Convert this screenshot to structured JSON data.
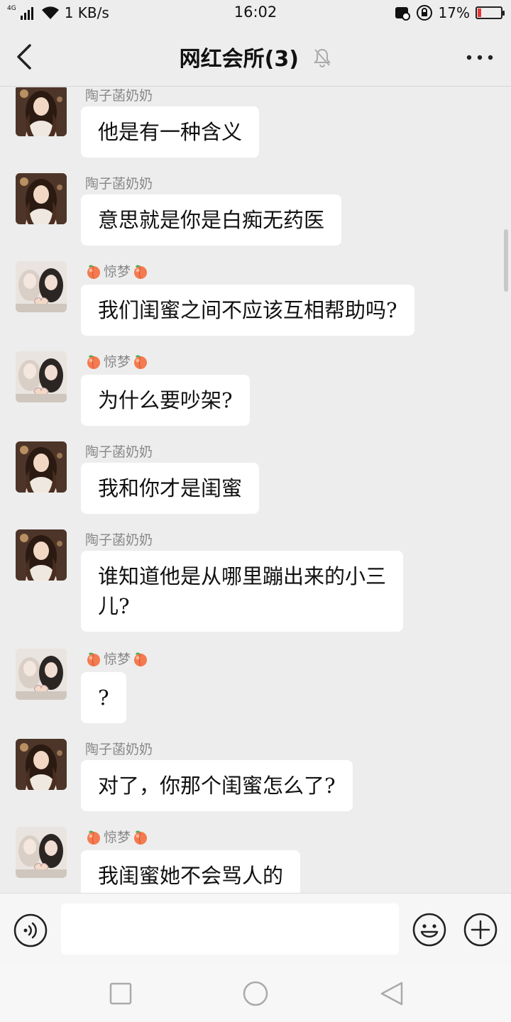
{
  "status_bar": {
    "network_tag": "4G",
    "speed": "1 KB/s",
    "time": "16:02",
    "battery": "17%",
    "battery_level": 0.17
  },
  "header": {
    "title": "网红会所(3)",
    "back_icon": "chevron-left-icon",
    "mute_icon": "bell-off-icon",
    "more_icon": "more-horizontal-icon"
  },
  "messages": [
    {
      "sender": "陶子菡奶奶",
      "text": "他是有一种含义"
    },
    {
      "sender": "陶子菡奶奶",
      "text": "意思就是你是白痴无药医"
    },
    {
      "sender": "惊梦",
      "text": "我们闺蜜之间不应该互相帮助吗?"
    },
    {
      "sender": "惊梦",
      "text": "为什么要吵架?"
    },
    {
      "sender": "陶子菡奶奶",
      "text": "我和你才是闺蜜"
    },
    {
      "sender": "陶子菡奶奶",
      "text_line1": "谁知道他是从哪里蹦出来的小三",
      "text_line2": "儿?"
    },
    {
      "sender": "惊梦",
      "text": "?"
    },
    {
      "sender": "陶子菡奶奶",
      "text": "对了，你那个闺蜜怎么了?"
    },
    {
      "sender": "惊梦",
      "text": "我闺蜜她不会骂人的"
    }
  ],
  "input_bar": {
    "voice_icon": "voice-icon",
    "text_value": "",
    "emoji_icon": "emoji-icon",
    "plus_icon": "plus-icon"
  },
  "nav_bar": {
    "recents_icon": "square-icon",
    "home_icon": "circle-icon",
    "back_icon": "triangle-back-icon"
  },
  "colors": {
    "background": "#ededed",
    "bubble": "#ffffff",
    "nickname": "#888888",
    "battery_low": "#e53935"
  }
}
